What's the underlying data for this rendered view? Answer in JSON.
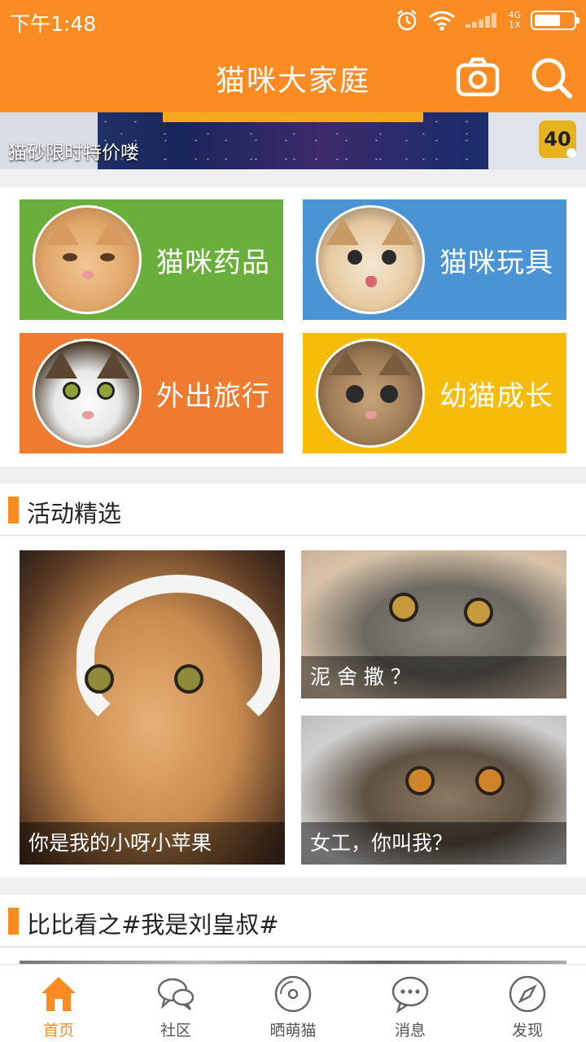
{
  "status_bar": {
    "time": "下午1:48",
    "network_top": "4G",
    "network_bottom": "1X"
  },
  "app_bar": {
    "title": "猫咪大家庭",
    "camera_icon": "camera-icon",
    "search_icon": "search-icon"
  },
  "banner": {
    "caption": "猫砂限时特价喽",
    "badge": "40"
  },
  "categories": [
    {
      "label": "猫咪药品",
      "color": "#6aaf3c"
    },
    {
      "label": "猫咪玩具",
      "color": "#4b94d4"
    },
    {
      "label": "外出旅行",
      "color": "#ee7b30"
    },
    {
      "label": "幼猫成长",
      "color": "#f7bb0a"
    }
  ],
  "section_activities": {
    "title": "活动精选",
    "items": [
      {
        "caption": "你是我的小呀小苹果"
      },
      {
        "caption": "泥 舍 撒 ？"
      },
      {
        "caption": "女工，你叫我？"
      }
    ]
  },
  "section_compare": {
    "title": "比比看之#我是刘皇叔#"
  },
  "tabbar": {
    "items": [
      {
        "label": "首页",
        "icon": "home-icon",
        "active": true
      },
      {
        "label": "社区",
        "icon": "chat-bubbles-icon",
        "active": false
      },
      {
        "label": "晒萌猫",
        "icon": "disc-icon",
        "active": false
      },
      {
        "label": "消息",
        "icon": "message-icon",
        "active": false
      },
      {
        "label": "发现",
        "icon": "compass-icon",
        "active": false
      }
    ],
    "accent": "#fb8c24"
  }
}
